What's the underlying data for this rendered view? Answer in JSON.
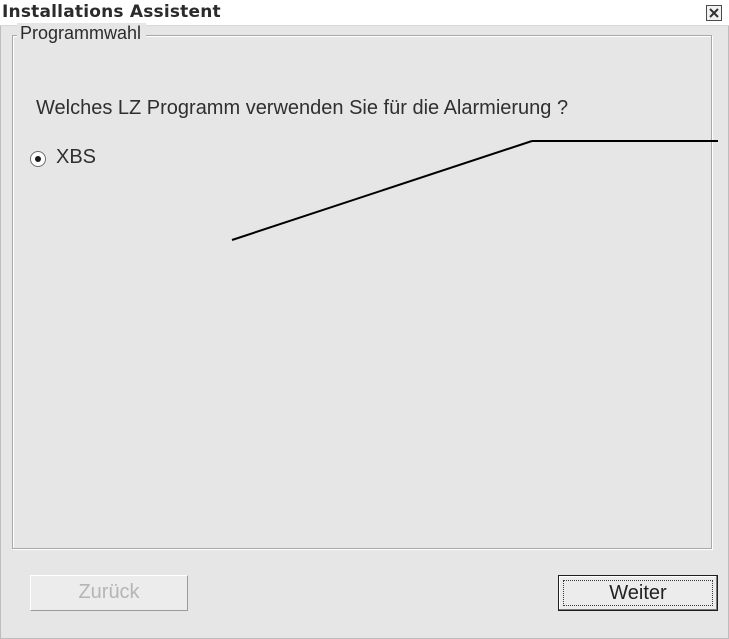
{
  "window": {
    "title": "Installations Assistent",
    "close_icon": "close-icon"
  },
  "group": {
    "legend": "Programmwahl",
    "question": "Welches LZ Programm verwenden Sie für die Alarmierung ?",
    "options": [
      {
        "label": "XBS",
        "selected": true
      }
    ]
  },
  "buttons": {
    "back_label": "Zurück",
    "back_enabled": false,
    "next_label": "Weiter",
    "next_focused": true
  },
  "colors": {
    "window_background": "#e6e6e6",
    "titlebar_background": "#ffffff",
    "disabled_text": "#b5b5b5"
  }
}
